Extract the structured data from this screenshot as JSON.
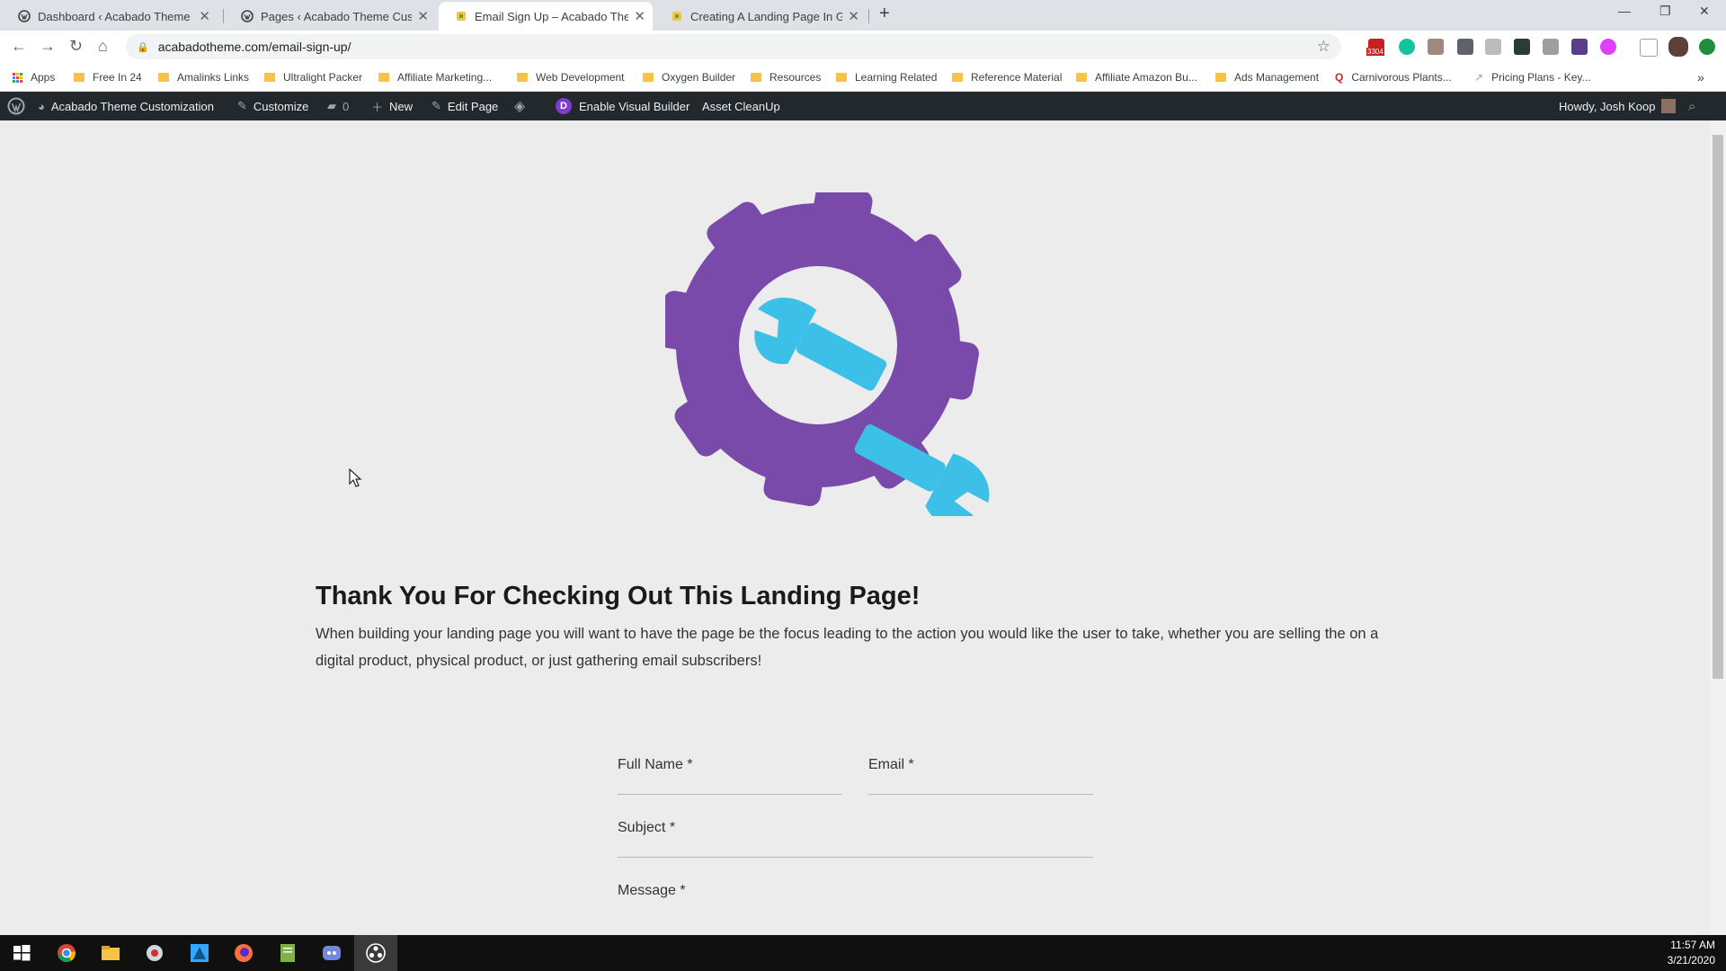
{
  "tabs": [
    {
      "title": "Dashboard ‹ Acabado Theme Cu",
      "active": false
    },
    {
      "title": "Pages ‹ Acabado Theme Custom",
      "active": false
    },
    {
      "title": "Email Sign Up – Acabado Theme",
      "active": true
    },
    {
      "title": "Creating A Landing Page In Gute",
      "active": false
    }
  ],
  "address_bar": {
    "url": "acabadotheme.com/email-sign-up/"
  },
  "extensions": {
    "gmail_badge": "3304"
  },
  "bookmarks": [
    "Apps",
    "Free In 24",
    "Amalinks Links",
    "Ultralight Packer",
    "Affiliate Marketing...",
    "Web Development",
    "Oxygen Builder",
    "Resources",
    "Learning Related",
    "Reference Material",
    "Affiliate Amazon Bu...",
    "Ads Management",
    "Carnivorous Plants...",
    "Pricing Plans - Key..."
  ],
  "admin_bar": {
    "site_name": "Acabado Theme Customization",
    "customize": "Customize",
    "comments_count": "0",
    "new": "New",
    "edit_page": "Edit Page",
    "visual_builder": "Enable Visual Builder",
    "asset_cleanup": "Asset CleanUp",
    "howdy": "Howdy, Josh Koop"
  },
  "colors": {
    "gear": "#7a4aab",
    "wrench": "#3cc0e8",
    "admin_bar": "#23282d"
  },
  "page": {
    "headline": "Thank You For Checking Out This Landing Page!",
    "intro": "When building your landing page you will want to have the page be the focus leading to the action you would like the user to take, whether you are selling the on a digital product, physical product, or just gathering email subscribers!"
  },
  "form": {
    "full_name_label": "Full Name *",
    "email_label": "Email *",
    "subject_label": "Subject *",
    "message_label": "Message *"
  },
  "clock": {
    "time": "11:57 AM",
    "date": "3/21/2020"
  }
}
